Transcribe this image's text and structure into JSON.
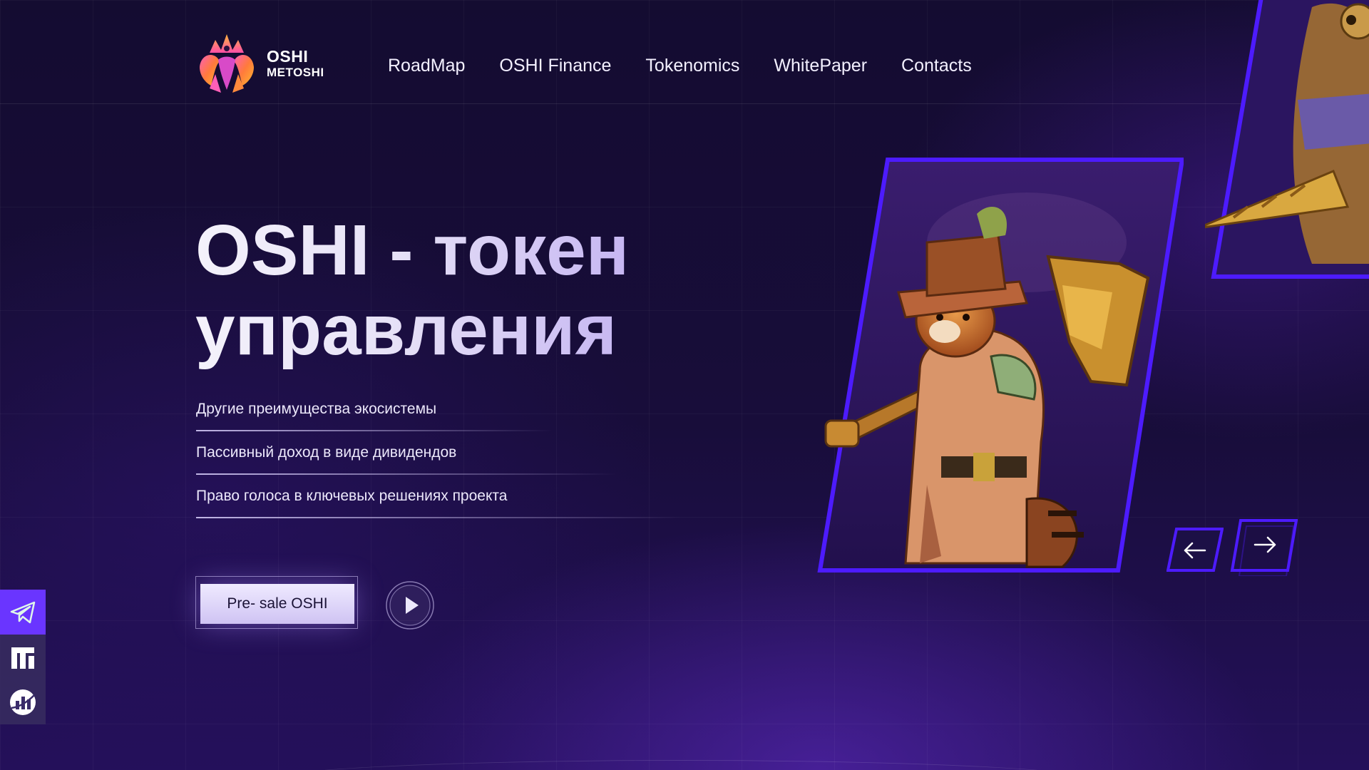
{
  "brand": {
    "line1": "OSHI",
    "line2": "METOSHI"
  },
  "nav": {
    "items": [
      {
        "label": "RoadMap",
        "active": true
      },
      {
        "label": "OSHI Finance"
      },
      {
        "label": "Tokenomics"
      },
      {
        "label": "WhitePaper"
      },
      {
        "label": "Contacts"
      }
    ]
  },
  "hero": {
    "title_line1": "OSHI - токен",
    "title_line2": "управления",
    "benefits": [
      "Другие преимущества экосистемы",
      "Пассивный доход в виде дивидендов",
      "Право  голоса в ключевых решениях проекта"
    ],
    "cta_label": "Pre- sale OSHI"
  },
  "icons": {
    "play": "play-icon",
    "telegram": "telegram-icon",
    "medium": "medium-icon",
    "chart": "chart-icon",
    "prev": "arrow-left-icon",
    "next": "arrow-right-icon"
  },
  "colors": {
    "accent": "#5a2cff",
    "telegram_bg": "#6a35ff",
    "background": "#160d36"
  }
}
